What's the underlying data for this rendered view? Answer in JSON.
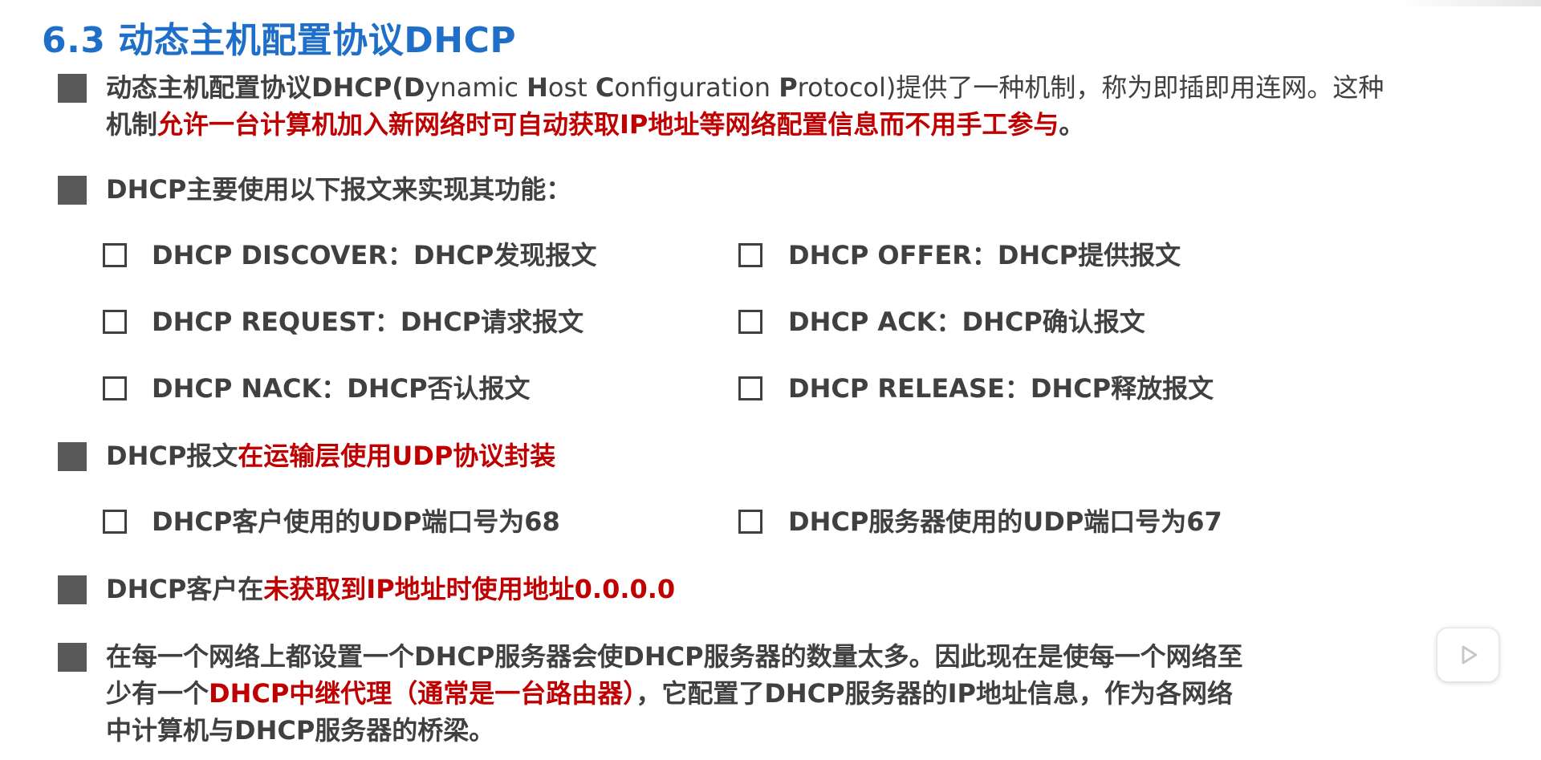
{
  "title": "6.3 动态主机配置协议DHCP",
  "bullets": {
    "b1": {
      "line1_prefix": "动态主机配置协议DHCP(",
      "line1_D": "D",
      "line1_ynamic": "ynamic ",
      "line1_H": "H",
      "line1_ost": "ost ",
      "line1_C": "C",
      "line1_onfiguration": "onfiguration ",
      "line1_P": "P",
      "line1_rotocol": "rotocol)提供了一种机制，称为即插即用连网。这种",
      "line2_prefix": "机制",
      "line2_red": "允许一台计算机加入新网络时可自动获取IP地址等网络配置信息而不用手工参与",
      "line2_suffix": "。"
    },
    "b2": {
      "text": "DHCP主要使用以下报文来实现其功能："
    },
    "b3": {
      "prefix": "DHCP报文",
      "red": "在运输层使用UDP协议封装"
    },
    "b4": {
      "prefix": "DHCP客户在",
      "red": "未获取到IP地址时使用地址0.0.0.0"
    },
    "b5": {
      "line1": "在每一个网络上都设置一个DHCP服务器会使DHCP服务器的数量太多。因此现在是使每一个网络至",
      "line2_prefix": "少有一个",
      "line2_red": "DHCP中继代理（通常是一台路由器）",
      "line2_suffix": "，它配置了DHCP服务器的IP地址信息，作为各网络",
      "line3": "中计算机与DHCP服务器的桥梁。"
    }
  },
  "messages": [
    {
      "text": "DHCP DISCOVER：DHCP发现报文"
    },
    {
      "text": "DHCP OFFER：DHCP提供报文"
    },
    {
      "text": "DHCP REQUEST：DHCP请求报文"
    },
    {
      "text": "DHCP ACK：DHCP确认报文"
    },
    {
      "text": "DHCP NACK：DHCP否认报文"
    },
    {
      "text": "DHCP RELEASE：DHCP释放报文"
    }
  ],
  "ports": [
    {
      "text": "DHCP客户使用的UDP端口号为68"
    },
    {
      "text": "DHCP服务器使用的UDP端口号为67"
    }
  ],
  "colors": {
    "title": "#1f6fc8",
    "body": "#404040",
    "highlight": "#c00000",
    "bullet": "#595959"
  },
  "icons": {
    "bullet": "square-bullet-icon",
    "sub_bullet": "checkbox-icon",
    "player": "play-icon"
  }
}
